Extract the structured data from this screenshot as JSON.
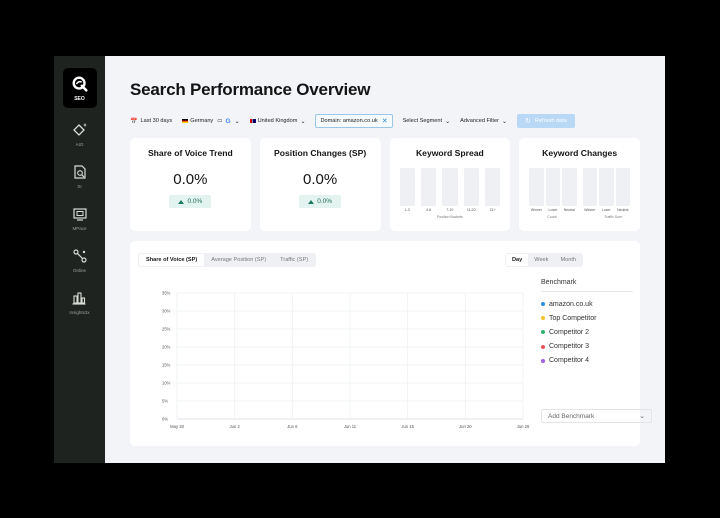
{
  "sidebar": {
    "logo_label": "SEO",
    "items": [
      {
        "label": "AIO",
        "icon": "sparkle-diamond-icon"
      },
      {
        "label": "SI",
        "icon": "search-document-icon"
      },
      {
        "label": "MPace",
        "icon": "monitor-icon"
      },
      {
        "label": "Online",
        "icon": "nodes-icon"
      },
      {
        "label": "Insights3x",
        "icon": "bar-chart-icon"
      }
    ]
  },
  "page": {
    "title": "Search Performance Overview"
  },
  "filters": {
    "date": "Last 30 days",
    "country": "Germany",
    "market": "United Kingdom",
    "domain": "Domain: amazon.co.uk",
    "segment": "Select Segment",
    "advanced": "Advanced Filter",
    "refresh": "Refresh data"
  },
  "cards": {
    "sov": {
      "title": "Share of Voice Trend",
      "value": "0.0%",
      "delta": "0.0%"
    },
    "position": {
      "title": "Position Changes (SP)",
      "value": "0.0%",
      "delta": "0.0%"
    },
    "spread": {
      "title": "Keyword Spread",
      "buckets": [
        "1-3",
        "4-6",
        "7-10",
        "11-20",
        "21+"
      ],
      "sub": "Position Buckets"
    },
    "changes": {
      "title": "Keyword Changes",
      "labels": [
        "Winner",
        "Loser",
        "Neutral",
        "Winner",
        "Loser",
        "Neutral"
      ],
      "sub_left": "Count",
      "sub_right": "Traffic Sum"
    }
  },
  "chart_tabs": [
    "Share of Voice (SP)",
    "Average Position (SP)",
    "Traffic (SP)"
  ],
  "range_tabs": [
    "Day",
    "Week",
    "Month"
  ],
  "benchmark": {
    "title": "Benchmark",
    "items": [
      {
        "label": "amazon.co.uk",
        "color": "#2f8de4"
      },
      {
        "label": "Top Competitor",
        "color": "#f2c230"
      },
      {
        "label": "Competitor 2",
        "color": "#2fb36f"
      },
      {
        "label": "Competitor 3",
        "color": "#e8525b"
      },
      {
        "label": "Competitor 4",
        "color": "#a35ee6"
      }
    ],
    "add_label": "Add Benchmark"
  },
  "chart_data": {
    "type": "line",
    "x": [
      "May 28",
      "Jun 2",
      "Jun 6",
      "Jun 11",
      "Jun 15",
      "Jun 20",
      "Jun 26"
    ],
    "y_ticks": [
      "0%",
      "5%",
      "10%",
      "15%",
      "20%",
      "25%",
      "30%",
      "35%"
    ],
    "ylim": [
      0,
      35
    ],
    "grid": true,
    "series": []
  }
}
